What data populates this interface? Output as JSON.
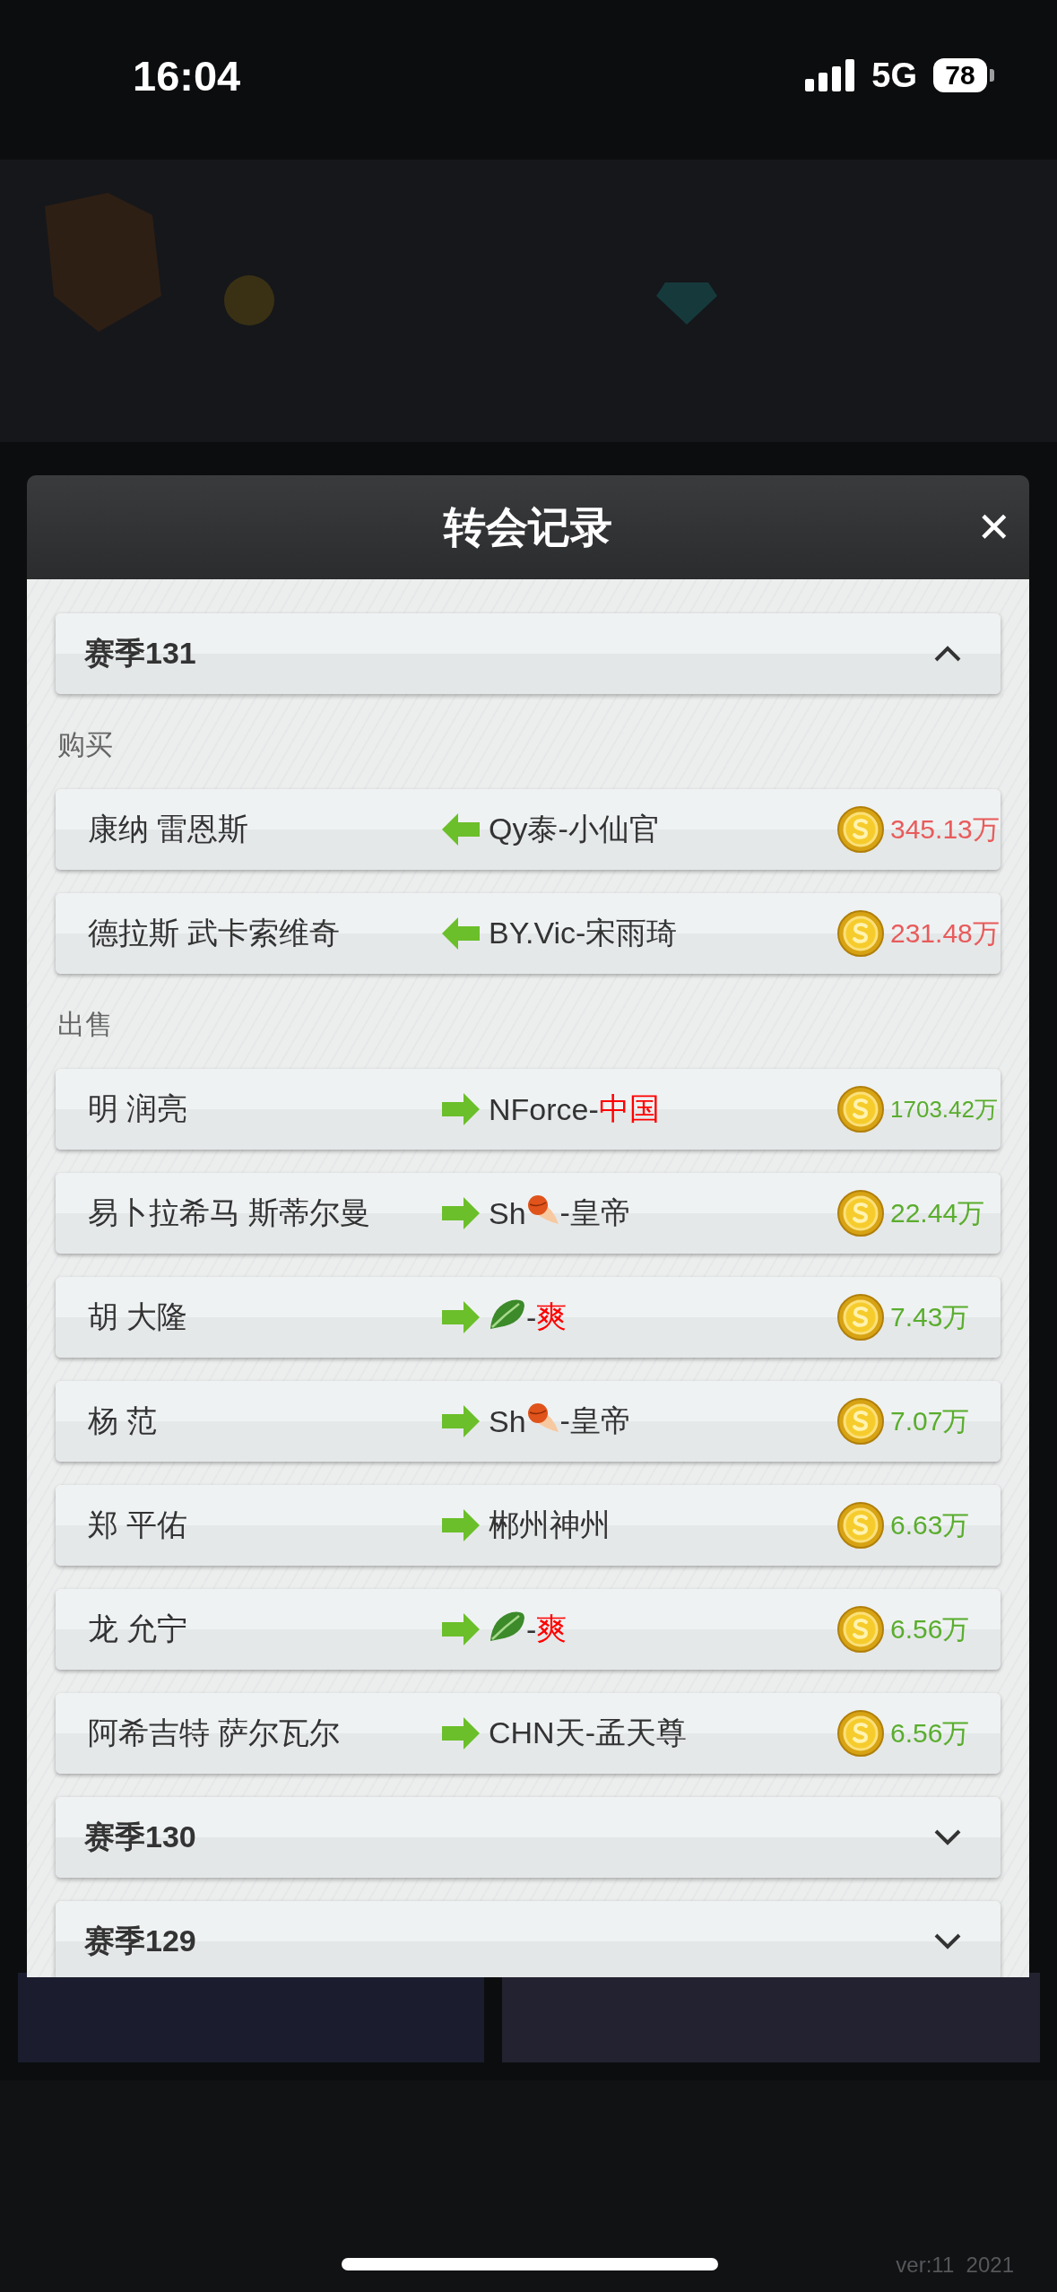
{
  "status_bar": {
    "time": "16:04",
    "network": "5G",
    "battery": "78"
  },
  "modal": {
    "title": "转会记录",
    "close": "✕"
  },
  "seasons": [
    {
      "title": "赛季131",
      "expanded": true,
      "sections": [
        {
          "label": "购买",
          "kind": "buy",
          "rows": [
            {
              "player": "康纳 雷恩斯",
              "team": [
                {
                  "kind": "text",
                  "text": "Qy泰-小仙官"
                }
              ],
              "price": "345.13万"
            },
            {
              "player": "德拉斯 武卡索维奇",
              "team": [
                {
                  "kind": "text",
                  "text": "BY.Vic-宋雨琦"
                }
              ],
              "price": "231.48万"
            }
          ]
        },
        {
          "label": "出售",
          "kind": "sell",
          "rows": [
            {
              "player": "明 润亮",
              "team": [
                {
                  "kind": "text",
                  "text": "NForce-"
                },
                {
                  "kind": "accent",
                  "text": "中国"
                }
              ],
              "price": "1703.42万"
            },
            {
              "player": "易卜拉希马 斯蒂尔曼",
              "team": [
                {
                  "kind": "text",
                  "text": "Sh"
                },
                {
                  "kind": "ball"
                },
                {
                  "kind": "text",
                  "text": "-皇帝"
                }
              ],
              "price": "22.44万"
            },
            {
              "player": "胡 大隆",
              "team": [
                {
                  "kind": "leaf"
                },
                {
                  "kind": "text",
                  "text": "-"
                },
                {
                  "kind": "accent",
                  "text": "爽"
                }
              ],
              "price": "7.43万"
            },
            {
              "player": "杨 范",
              "team": [
                {
                  "kind": "text",
                  "text": "Sh"
                },
                {
                  "kind": "ball"
                },
                {
                  "kind": "text",
                  "text": "-皇帝"
                }
              ],
              "price": "7.07万"
            },
            {
              "player": "郑 平佑",
              "team": [
                {
                  "kind": "text",
                  "text": "郴州神州"
                }
              ],
              "price": "6.63万"
            },
            {
              "player": "龙 允宁",
              "team": [
                {
                  "kind": "leaf"
                },
                {
                  "kind": "text",
                  "text": "-"
                },
                {
                  "kind": "accent",
                  "text": "爽"
                }
              ],
              "price": "6.56万"
            },
            {
              "player": "阿希吉特 萨尔瓦尔",
              "team": [
                {
                  "kind": "text",
                  "text": "CHN天-孟天尊"
                }
              ],
              "price": "6.56万"
            }
          ]
        }
      ]
    },
    {
      "title": "赛季130",
      "expanded": false
    },
    {
      "title": "赛季129",
      "expanded": false
    }
  ],
  "version": "ver:11  2021"
}
